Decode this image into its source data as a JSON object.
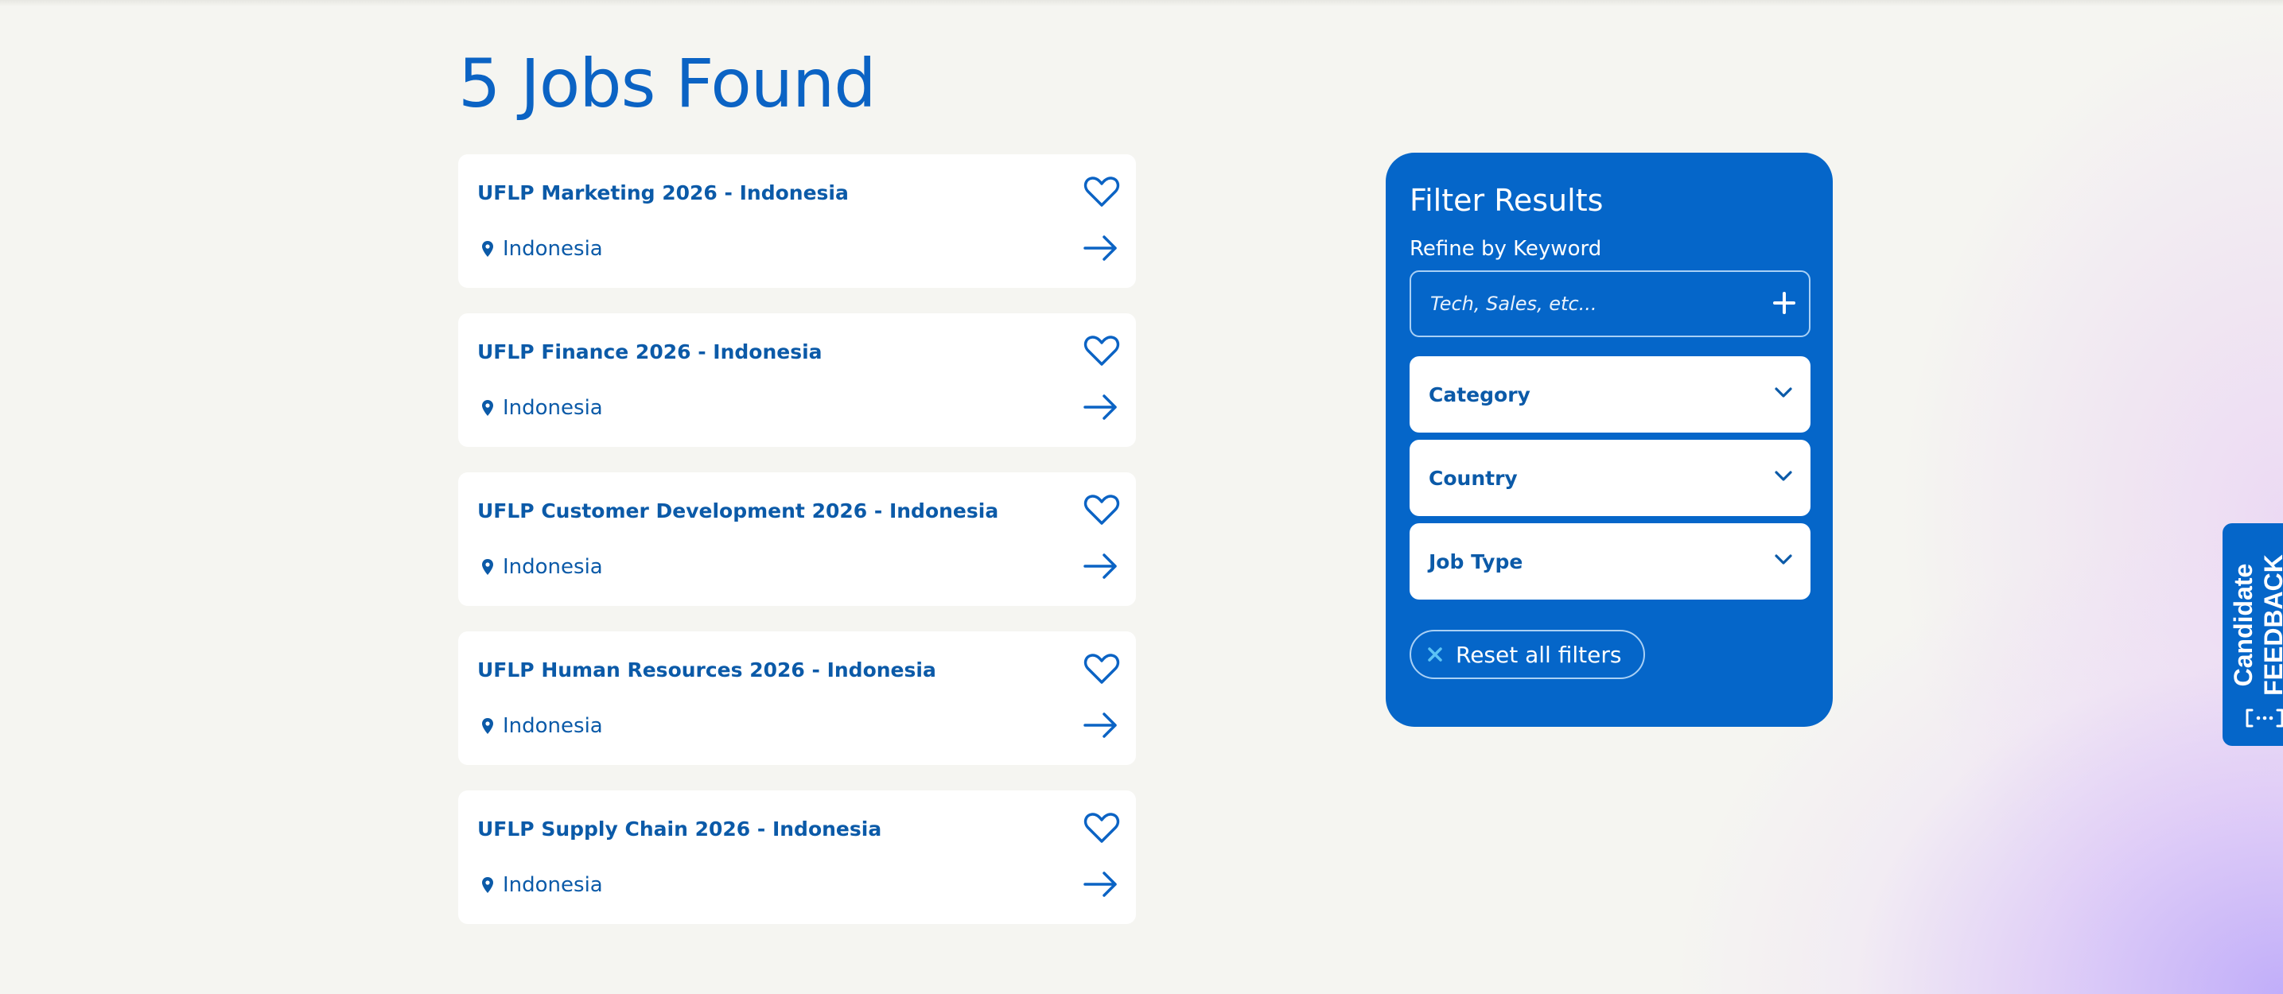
{
  "page": {
    "title": "5 Jobs Found"
  },
  "jobs": [
    {
      "title": "UFLP Marketing 2026 - Indonesia",
      "location": "Indonesia"
    },
    {
      "title": "UFLP Finance 2026 - Indonesia",
      "location": "Indonesia"
    },
    {
      "title": "UFLP Customer Development 2026 - Indonesia",
      "location": "Indonesia"
    },
    {
      "title": "UFLP Human Resources 2026 - Indonesia",
      "location": "Indonesia"
    },
    {
      "title": "UFLP Supply Chain 2026 - Indonesia",
      "location": "Indonesia"
    }
  ],
  "filters": {
    "title": "Filter Results",
    "keyword_label": "Refine by Keyword",
    "keyword_placeholder": "Tech, Sales, etc...",
    "dropdowns": [
      {
        "label": "Category"
      },
      {
        "label": "Country"
      },
      {
        "label": "Job Type"
      }
    ],
    "reset_label": "Reset all filters"
  },
  "feedback": {
    "line1": "Candidate",
    "line2": "FEEDBACK"
  },
  "icons": {
    "favorite": "heart-outline-icon",
    "open": "arrow-right-icon",
    "location": "map-pin-icon",
    "add": "plus-icon",
    "expand": "chevron-down-icon",
    "reset": "x-icon",
    "feedback": "bracket-dots-icon"
  },
  "colors": {
    "brand_blue": "#0566c9",
    "title_blue": "#0b63c4",
    "text_blue": "#0b5aa8",
    "reset_x": "#5cc4f5",
    "background": "#f5f5f1"
  }
}
